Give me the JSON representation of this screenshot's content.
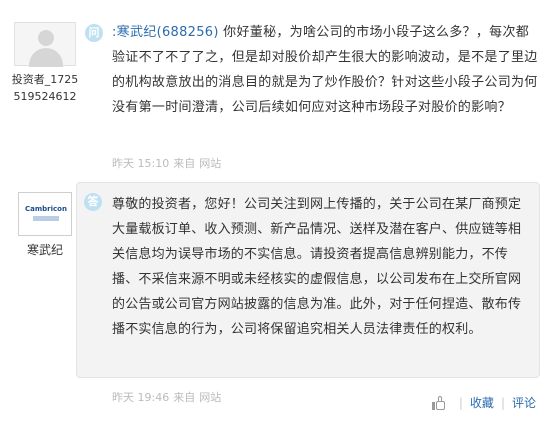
{
  "question": {
    "asker_name": "投资者_1725",
    "asker_id": "519524612",
    "badge": "问",
    "mention": ":寒武纪(688256)",
    "text": " 你好董秘，为啥公司的市场小段子这么多？，每次都验证不了不了了之，但是却对股价却产生很大的影响波动，是不是了里边的机构故意放出的消息目的就是为了炒作股价？针对这些小段子公司为何没有第一时间澄清，公司后续如何应对这种市场段子对股价的影响？",
    "time": "昨天 15:10",
    "source_prefix": "来自",
    "source": "网站"
  },
  "answer": {
    "answerer_name": "寒武纪",
    "logo_text": "Cambricon",
    "badge": "答",
    "text": "尊敬的投资者，您好！公司关注到网上传播的，关于公司在某厂商预定大量载板订单、收入预测、新产品情况、送样及潜在客户、供应链等相关信息均为误导市场的不实信息。请投资者提高信息辨别能力，不传播、不采信来源不明或未经核实的虚假信息，以公司发布在上交所官网的公告或公司官方网站披露的信息为准。此外，对于任何捏造、散布传播不实信息的行为，公司将保留追究相关人员法律责任的权利。",
    "time": "昨天 19:46",
    "source_prefix": "来自",
    "source": "网站"
  },
  "actions": {
    "like_icon": "thumbs-up-icon",
    "favorite_label": "收藏",
    "separator": "|",
    "comment_label": "评论"
  }
}
